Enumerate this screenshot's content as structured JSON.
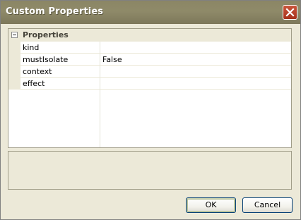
{
  "window": {
    "title": "Custom Properties"
  },
  "grid": {
    "category": "Properties",
    "properties": [
      {
        "name": "kind",
        "value": ""
      },
      {
        "name": "mustIsolate",
        "value": "False"
      },
      {
        "name": "context",
        "value": ""
      },
      {
        "name": "effect",
        "value": ""
      }
    ]
  },
  "buttons": {
    "ok": "OK",
    "cancel": "Cancel"
  },
  "icons": {
    "close": "close-icon",
    "collapse": "collapse-icon"
  },
  "colors": {
    "titlebar": "#8b8665",
    "dialog_bg": "#ECE9D8",
    "close_button": "#b83c22"
  }
}
